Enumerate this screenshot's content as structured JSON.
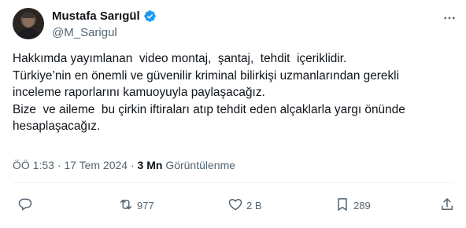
{
  "author": {
    "display_name": "Mustafa Sarıgül",
    "handle": "@M_Sarigul",
    "verified": true
  },
  "tweet": {
    "lines": [
      "Hakkımda yayımlanan  video montaj,  şantaj,  tehdit  içeriklidir.",
      "Türkiye’nin en önemli ve güvenilir kriminal bilirkişi uzmanlarından gerekli",
      "inceleme raporlarını kamuoyuyla paylaşacağız.",
      "Bize  ve aileme  bu çirkin iftiraları atıp tehdit eden alçaklarla yargı önünde",
      "hesaplaşacağız."
    ],
    "time": "ÖÖ 1:53",
    "separator": "·",
    "date": "17 Tem 2024",
    "views_count": "3 Mn",
    "views_label": "Görüntülenme"
  },
  "actions": {
    "reply_count": "",
    "retweet_count": "977",
    "like_count": "2 B",
    "bookmark_count": "289"
  },
  "colors": {
    "text": "#0f1419",
    "secondary": "#536471",
    "verified": "#1d9bf0"
  },
  "icons": [
    "more-icon",
    "reply-icon",
    "retweet-icon",
    "like-icon",
    "bookmark-icon",
    "share-icon",
    "verified-badge-icon"
  ]
}
